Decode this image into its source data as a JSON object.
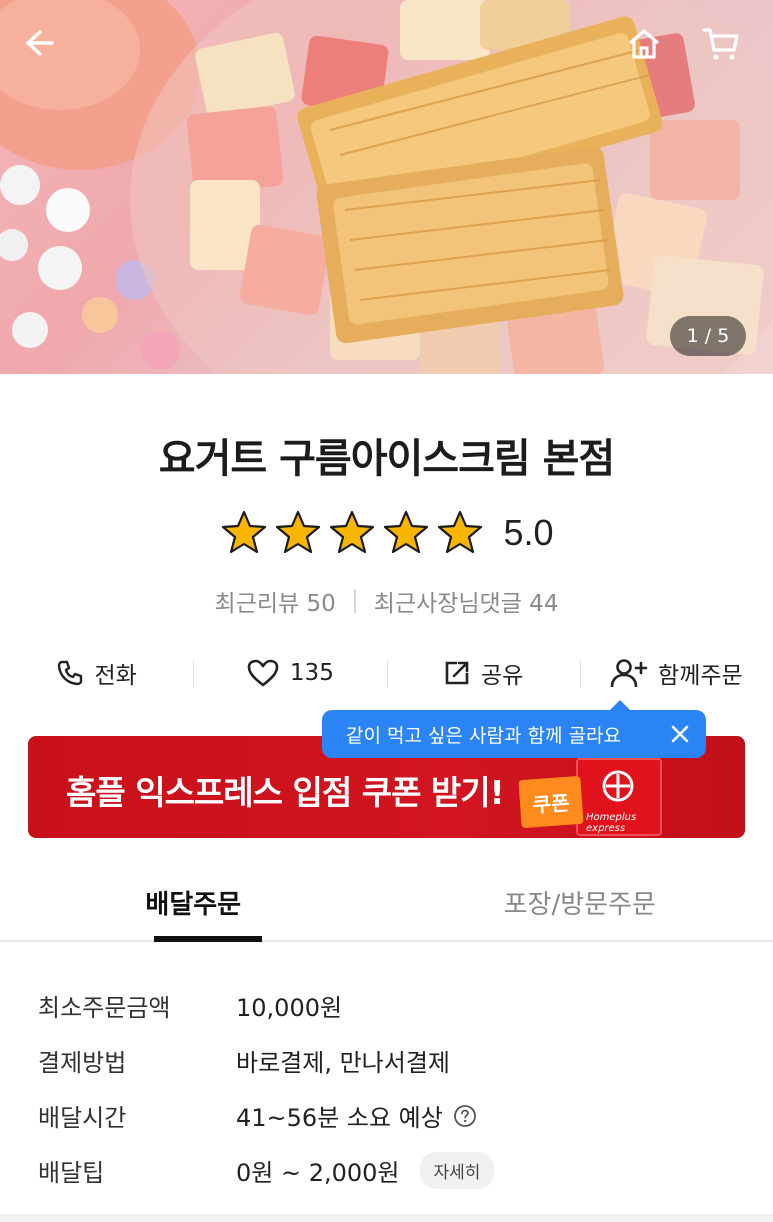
{
  "hero": {
    "image_counter": "1 / 5"
  },
  "store": {
    "name": "요거트 구름아이스크림 본점",
    "rating": "5.0",
    "stars": 5,
    "recent_reviews": "최근리뷰 50",
    "owner_replies": "최근사장님댓글 44"
  },
  "actions": {
    "call": "전화",
    "like_count": "135",
    "share": "공유",
    "group_order": "함께주문"
  },
  "tooltip": {
    "text": "같이 먹고 싶은 사람과 함께 골라요"
  },
  "banner": {
    "text": "홈플 익스프레스 입점 쿠폰 받기!",
    "coupon_tag": "쿠폰",
    "brand": "Homeplus express",
    "bg_color": "#d21520"
  },
  "tabs": [
    {
      "label": "배달주문",
      "active": true
    },
    {
      "label": "포장/방문주문",
      "active": false
    }
  ],
  "info": {
    "min_order_key": "최소주문금액",
    "min_order_val": "10,000원",
    "payment_key": "결제방법",
    "payment_val": "바로결제, 만나서결제",
    "time_key": "배달시간",
    "time_val": "41~56분 소요 예상",
    "tip_key": "배달팁",
    "tip_val": "0원 ~ 2,000원",
    "detail_btn": "자세히"
  },
  "colors": {
    "tooltip": "#2a84f5",
    "star": "#f7b500",
    "banner": "#d21520"
  }
}
